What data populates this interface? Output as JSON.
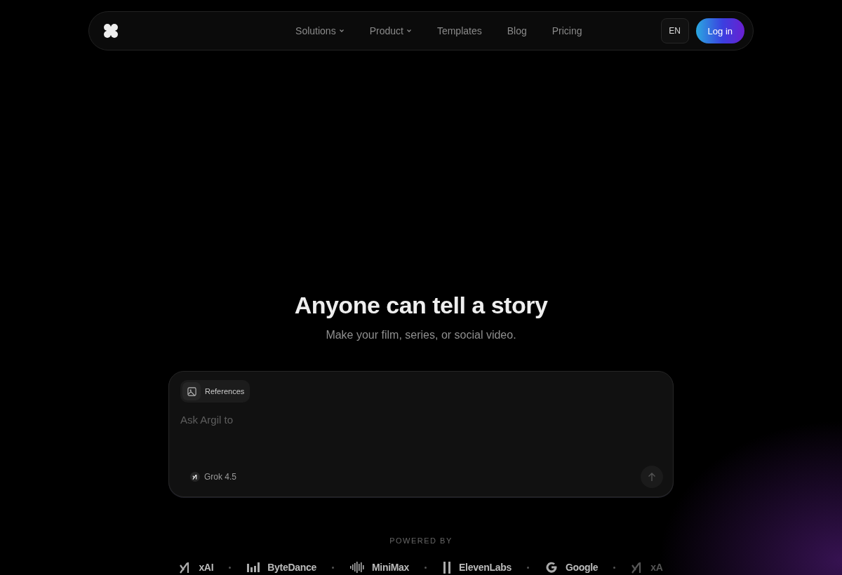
{
  "nav": {
    "items": [
      {
        "label": "Solutions",
        "dropdown": true
      },
      {
        "label": "Product",
        "dropdown": true
      },
      {
        "label": "Templates",
        "dropdown": false
      },
      {
        "label": "Blog",
        "dropdown": false
      },
      {
        "label": "Pricing",
        "dropdown": false
      }
    ],
    "language": "EN",
    "login": "Log in"
  },
  "hero": {
    "title": "Anyone can tell a story",
    "subtitle": "Make your film, series, or social video."
  },
  "composer": {
    "references": "References",
    "placeholder": "Ask Argil to",
    "model": "Grok 4.5"
  },
  "powered_by": {
    "label": "POWERED BY",
    "logos": [
      {
        "kind": "xai",
        "name": "xAI"
      },
      {
        "kind": "bytedance",
        "name": "ByteDance"
      },
      {
        "kind": "minimax",
        "name": "MiniMax"
      },
      {
        "kind": "elevenlabs",
        "name": "ElevenLabs"
      },
      {
        "kind": "google",
        "name": "Google"
      },
      {
        "kind": "xai",
        "name": "xA"
      }
    ]
  }
}
